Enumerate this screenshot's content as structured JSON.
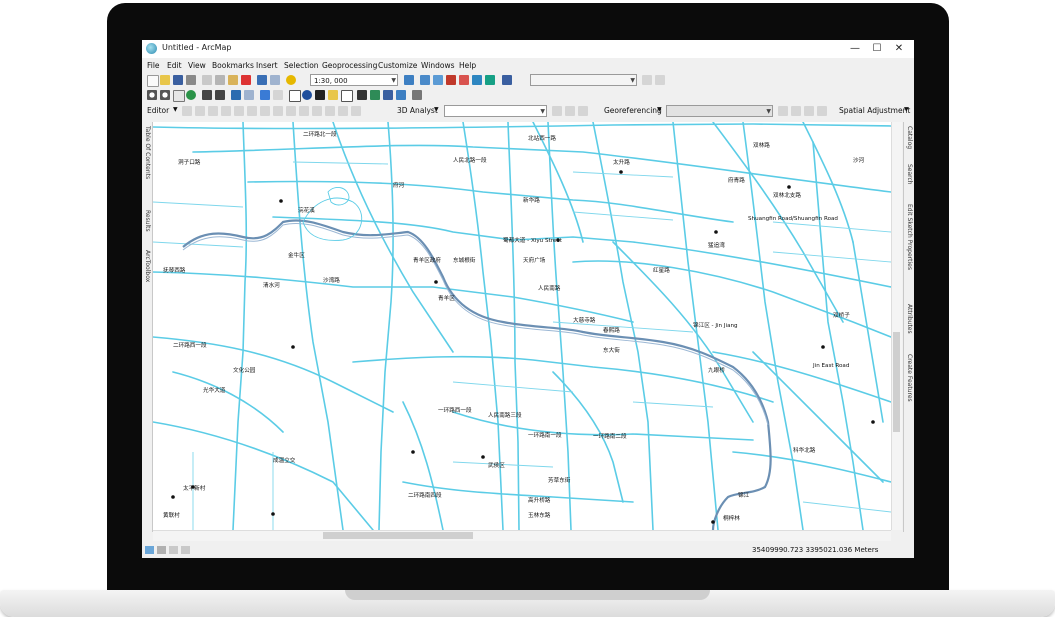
{
  "window": {
    "title": "Untitled - ArcMap",
    "minimize_glyph": "—",
    "maximize_glyph": "☐",
    "close_glyph": "✕"
  },
  "menu": [
    "File",
    "Edit",
    "View",
    "Bookmarks",
    "Insert",
    "Selection",
    "Geoprocessing",
    "Customize",
    "Windows",
    "Help"
  ],
  "toolbar": {
    "scale_value": "1:30, 000"
  },
  "toolbar3": {
    "editor_label": "Editor",
    "analyst_label": "3D Analyst",
    "georef_label": "Georeferencing",
    "spatial_adj_label": "Spatial Adjustment"
  },
  "left_dock_tabs": [
    "Table Of Contents",
    "Results",
    "ArcToolbox"
  ],
  "right_dock_tabs": [
    "Catalog",
    "Search",
    "Edit Sketch Properties",
    "Attributes",
    "Create Features"
  ],
  "status": {
    "coordinates": "35409990.723  3395021.036 Meters"
  },
  "map": {
    "labels": {
      "l1": "二环路北一段",
      "l2": "洞子口路",
      "l3": "人民北路一段",
      "l4": "北站西一路",
      "l5": "府河",
      "l6": "双林路",
      "l7": "沙河",
      "l8": "新华路",
      "l9": "双林北支路",
      "l10": "太升路",
      "l11": "Shuangfin Road/Shuangfin Road",
      "l12": "猛追湾",
      "l13": "蜀都大道 - Xiyu Street",
      "l14": "东城根街",
      "l15": "青羊区",
      "l16": "人民南路",
      "l17": "锦江区 - Jin Jiang",
      "l18": "浣花溪",
      "l19": "青羊区政府",
      "l20": "金牛区",
      "l21": "清水河",
      "l22": "文化公园",
      "l23": "一环路西一段",
      "l24": "一环路南一段",
      "l25": "一环路南二段",
      "l26": "人民南路三段",
      "l27": "武侯区",
      "l28": "高升桥路",
      "l29": "二环路南四段",
      "l30": "锦江",
      "l31": "Jin East Road",
      "l32": "东大街",
      "l33": "玉林东路",
      "l34": "桐梓林",
      "l35": "芳草东街",
      "l36": "太平新村",
      "l37": "黄联村",
      "l38": "科华北路",
      "l39": "九眼桥",
      "l40": "双桥子",
      "l41": "红星路",
      "l42": "大慈寺路",
      "l43": "春熙路",
      "l44": "天府广场",
      "l45": "抚琴西路",
      "l46": "光华大道",
      "l47": "成温立交",
      "l48": "二环路西一段",
      "l49": "沙湾路",
      "l50": "府青路"
    }
  }
}
